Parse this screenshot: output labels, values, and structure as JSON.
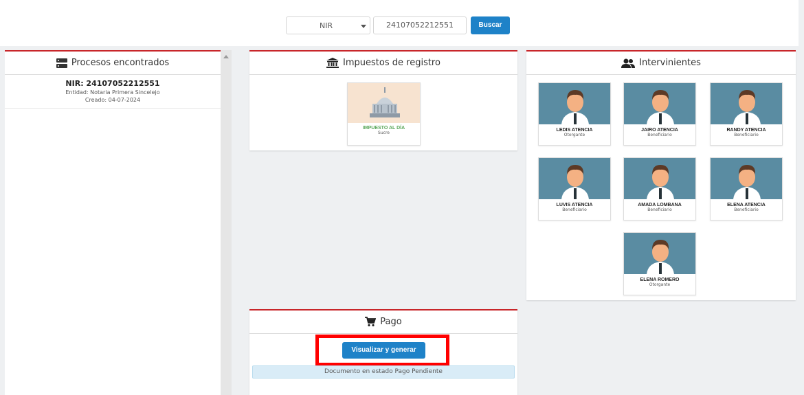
{
  "search": {
    "type_value": "NIR",
    "nir_value": "24107052212551",
    "button_label": "Buscar"
  },
  "procesos": {
    "title": "Procesos encontrados",
    "items": [
      {
        "nir": "NIR: 24107052212551",
        "entidad": "Entidad: Notaria Primera Sincelejo",
        "creado": "Creado: 04-07-2024"
      }
    ]
  },
  "impuestos": {
    "title": "Impuestos de registro",
    "tile_title": "IMPUESTO AL DÍA",
    "tile_sub": "Sucre"
  },
  "intervinientes": {
    "title": "Intervinientes",
    "people": [
      {
        "name": "LEDIS ATENCIA",
        "role": "Otorgante"
      },
      {
        "name": "JAIRO ATENCIA",
        "role": "Beneficiario"
      },
      {
        "name": "RANDY ATENCIA",
        "role": "Beneficiario"
      },
      {
        "name": "LUVIS ATENCIA",
        "role": "Beneficiario"
      },
      {
        "name": "AMADA LOMBANA",
        "role": "Beneficiario"
      },
      {
        "name": "ELENA ATENCIA",
        "role": "Beneficiario"
      },
      {
        "name": "ELENA ROMERO",
        "role": "Otorgante"
      }
    ]
  },
  "pago": {
    "title": "Pago",
    "button_label": "Visualizar y generar",
    "status": "Documento en estado Pago Pendiente"
  },
  "colors": {
    "accent": "#1e82c8",
    "panel_border": "#c8262a",
    "highlight": "#ff0000",
    "status_ok": "#5aa75a"
  }
}
